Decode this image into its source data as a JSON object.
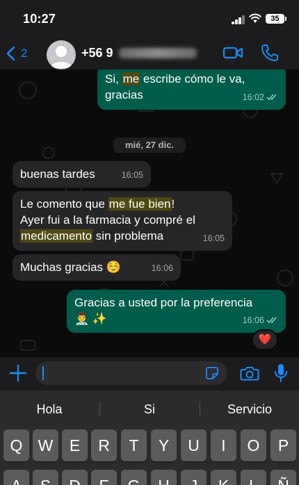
{
  "status_bar": {
    "time": "10:27",
    "battery": "35"
  },
  "header": {
    "back_count": "2",
    "contact_name": "+56 9"
  },
  "messages": [
    {
      "dir": "out",
      "lines": [
        [
          {
            "t": "Si, "
          },
          {
            "t": "me",
            "h": true
          },
          {
            "t": " escribe cómo le va,"
          }
        ],
        [
          {
            "t": "gracias"
          }
        ]
      ],
      "time": "16:02"
    },
    {
      "dir": "in",
      "lines": [
        [
          {
            "t": "buenas tardes"
          }
        ]
      ],
      "time": "16:05"
    },
    {
      "dir": "in",
      "lines": [
        [
          {
            "t": "Le comento que "
          },
          {
            "t": "me fue bien",
            "h": true
          },
          {
            "t": "!"
          }
        ],
        [
          {
            "t": "Ayer fui a la farmacia y compré el"
          }
        ],
        [
          {
            "t": "medicamento",
            "h": true
          },
          {
            "t": " sin problema"
          }
        ]
      ],
      "time": "16:05"
    },
    {
      "dir": "in",
      "lines": [
        [
          {
            "t": "Muchas gracias ☺️"
          }
        ]
      ],
      "time": "16:06"
    },
    {
      "dir": "out",
      "lines": [
        [
          {
            "t": "Gracias a usted por la preferencia"
          }
        ],
        [
          {
            "t": "👨‍⚕️ ✨"
          }
        ]
      ],
      "time": "16:06",
      "reaction": "❤️"
    }
  ],
  "date_separator": "mié, 27 dic.",
  "keyboard": {
    "suggestions": [
      "Hola",
      "Si",
      "Servicio"
    ],
    "row1": [
      "Q",
      "W",
      "E",
      "R",
      "T",
      "Y",
      "U",
      "I",
      "O",
      "P"
    ],
    "row2": [
      "A",
      "S",
      "D",
      "F",
      "G",
      "H",
      "J",
      "K",
      "L",
      "Ñ"
    ]
  },
  "colors": {
    "accent": "#1a8cff",
    "outgoing_bubble": "#005c4b",
    "incoming_bubble": "#262628",
    "highlight": "#4f4a12"
  }
}
